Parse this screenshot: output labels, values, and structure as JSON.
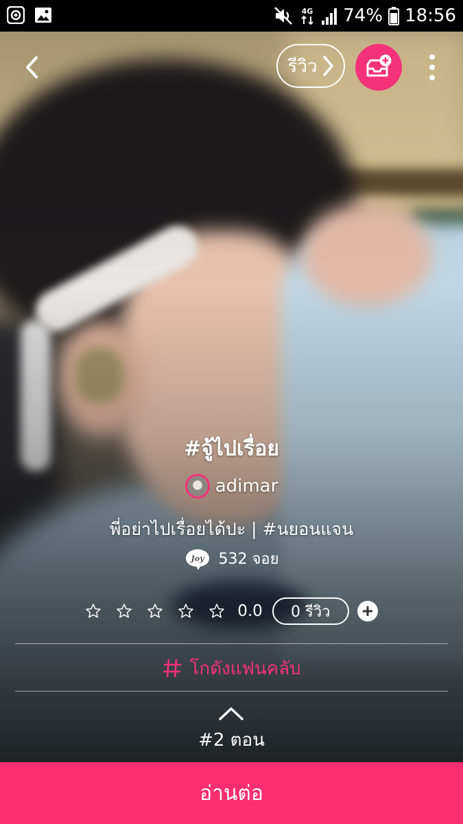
{
  "status_bar": {
    "battery": "74%",
    "network": "4G",
    "time": "18:56",
    "icons": [
      "screen-record-icon",
      "image-icon",
      "mute-icon",
      "network-4g-icon",
      "signal-icon",
      "battery-icon"
    ]
  },
  "top_bar": {
    "back_icon": "chevron-left-icon",
    "review_label": "รีวิว",
    "add_to_shelf_icon": "add-to-shelf-icon",
    "more_icon": "more-vertical-icon"
  },
  "story": {
    "title": "#จู้ไปเรื่อย",
    "author": "adimar",
    "tagline": "พี่อย่าไปเรื่อยได้ปะ | #นยอนแจน",
    "joy_badge": "Joy",
    "joy_count": "532 จอย",
    "rating": {
      "stars_filled": 0,
      "stars_total": 5,
      "value": "0.0",
      "review_count": "0 รีวิว"
    },
    "fanclub_label": "โกดังแฟนคลับ",
    "episode_label": "#2 ตอน"
  },
  "continue_button": "อ่านต่อ",
  "colors": {
    "accent": "#f5317a",
    "continue_button": "#fc2e72",
    "status_bar": "#000000",
    "text": "#ffffff"
  }
}
